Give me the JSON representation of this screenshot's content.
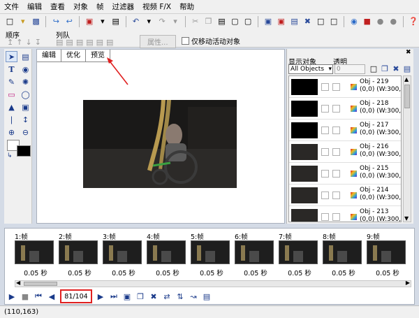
{
  "menu": [
    "文件",
    "编辑",
    "查看",
    "对象",
    "帧",
    "过滤器",
    "视频 F/X",
    "帮助"
  ],
  "toolbar2": {
    "order_label": "顺序",
    "queue_label": "列队",
    "properties_label": "属性...",
    "move_active_label": "仅移动活动对象"
  },
  "tabs": [
    "编辑",
    "优化",
    "预览"
  ],
  "right_panel": {
    "display_objects_label": "显示对象",
    "transparency_label": "透明",
    "filter_value": "All Objects",
    "transparency_value": "0",
    "objects": [
      {
        "name": "Obj - 219",
        "info": "(0,0) (W:300, H:"
      },
      {
        "name": "Obj - 218",
        "info": "(0,0) (W:300, H:"
      },
      {
        "name": "Obj - 217",
        "info": "(0,0) (W:300, H:"
      },
      {
        "name": "Obj - 216",
        "info": "(0,0) (W:300, H:"
      },
      {
        "name": "Obj - 215",
        "info": "(0,0) (W:300, H:"
      },
      {
        "name": "Obj - 214",
        "info": "(0,0) (W:300, H:"
      },
      {
        "name": "Obj - 213",
        "info": "(0,0) (W:300, H:"
      }
    ]
  },
  "frames": [
    {
      "label": "1:帧",
      "delay": "0.05 秒"
    },
    {
      "label": "2:帧",
      "delay": "0.05 秒"
    },
    {
      "label": "3:帧",
      "delay": "0.05 秒"
    },
    {
      "label": "4:帧",
      "delay": "0.05 秒"
    },
    {
      "label": "5:帧",
      "delay": "0.05 秒"
    },
    {
      "label": "6:帧",
      "delay": "0.05 秒"
    },
    {
      "label": "7:帧",
      "delay": "0.05 秒"
    },
    {
      "label": "8:帧",
      "delay": "0.05 秒"
    },
    {
      "label": "9:帧",
      "delay": "0.05 秒"
    }
  ],
  "frame_counter": "81/104",
  "status": "(110,163)",
  "colors": {
    "highlight_red": "#e02020",
    "accent_blue": "#1a3a8a"
  }
}
